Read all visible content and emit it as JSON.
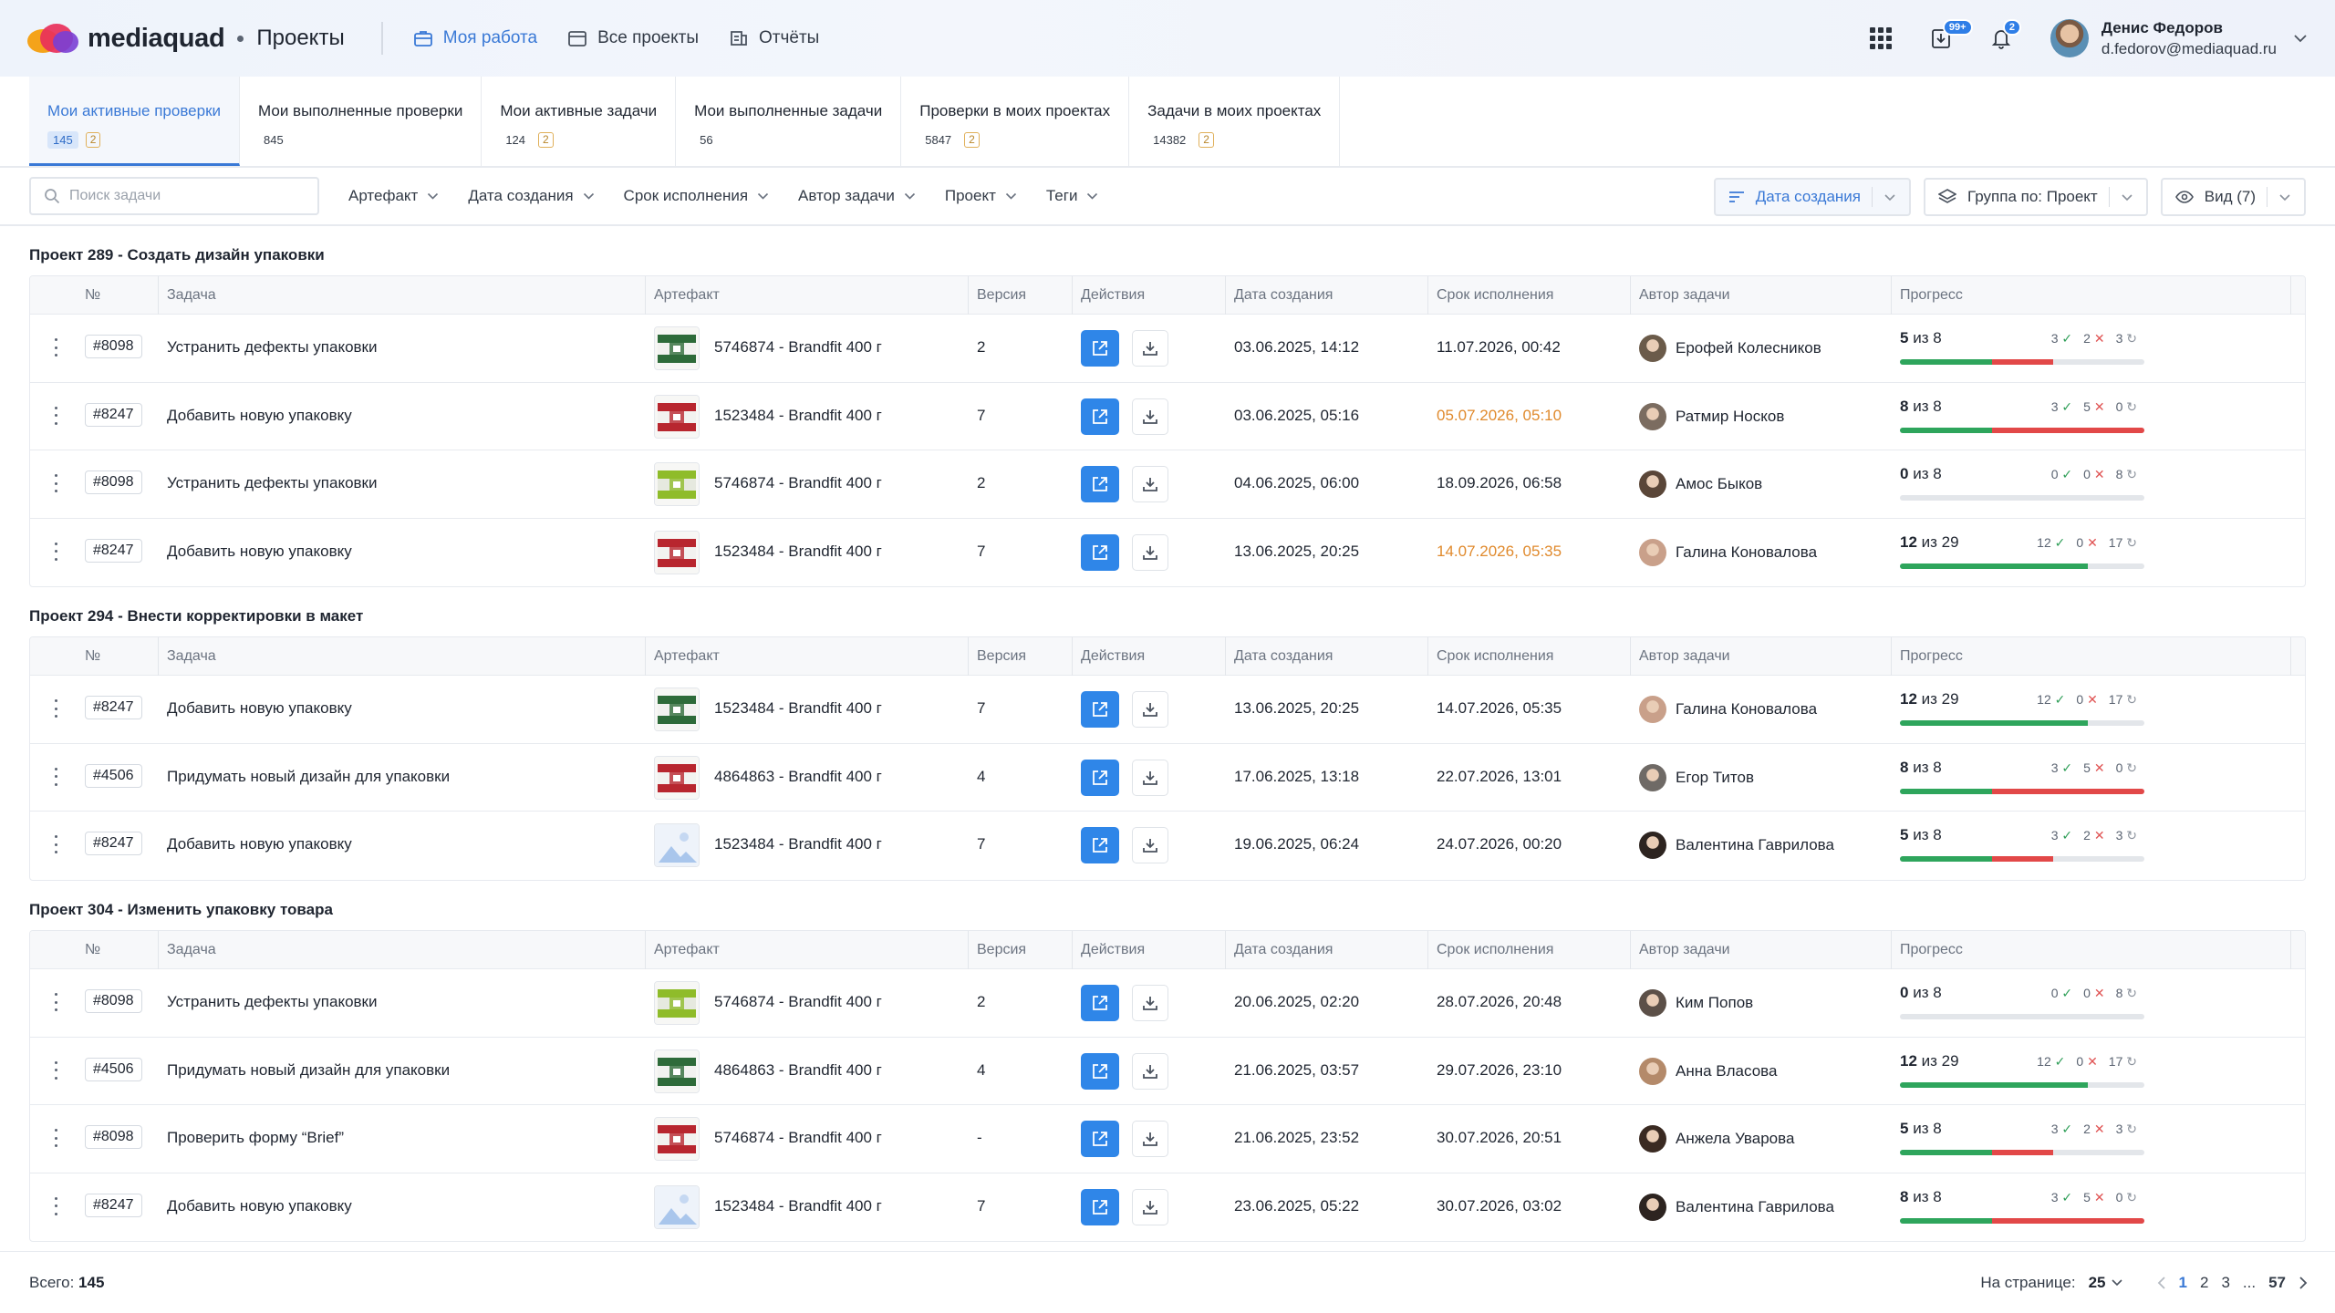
{
  "header": {
    "brand": "mediaquad",
    "section": "Проекты",
    "nav": [
      {
        "label": "Моя работа",
        "icon": "briefcase-icon",
        "active": true
      },
      {
        "label": "Все проекты",
        "icon": "calendar-icon",
        "active": false
      },
      {
        "label": "Отчёты",
        "icon": "report-icon",
        "active": false
      }
    ],
    "badges": {
      "downloads": "99+",
      "notifications": "2"
    },
    "user": {
      "name": "Денис Федоров",
      "email": "d.fedorov@mediaquad.ru"
    }
  },
  "tabs": [
    {
      "label": "Мои активные проверки",
      "count": "145",
      "warn": "2",
      "active": true
    },
    {
      "label": "Мои выполненные проверки",
      "count": "845",
      "warn": ""
    },
    {
      "label": "Мои активные задачи",
      "count": "124",
      "warn": "2"
    },
    {
      "label": "Мои выполненные задачи",
      "count": "56",
      "warn": ""
    },
    {
      "label": "Проверки в моих проектах",
      "count": "5847",
      "warn": "2"
    },
    {
      "label": "Задачи в моих проектах",
      "count": "14382",
      "warn": "2"
    }
  ],
  "filters": {
    "search_placeholder": "Поиск задачи",
    "items": [
      "Артефакт",
      "Дата создания",
      "Срок исполнения",
      "Автор задачи",
      "Проект",
      "Теги"
    ],
    "sort_label": "Дата создания",
    "group_label": "Группа по: Проект",
    "view_label": "Вид (7)"
  },
  "columns": [
    "№",
    "Задача",
    "Артефакт",
    "Версия",
    "Действия",
    "Дата создания",
    "Срок исполнения",
    "Автор задачи",
    "Прогресс"
  ],
  "groups": [
    {
      "title": "Проект 289 - Создать дизайн упаковки",
      "rows": [
        {
          "id": "#8098",
          "task": "Устранить дефекты упаковки",
          "thumb": "green",
          "artifact": "5746874 - Brandfit 400 г",
          "version": "2",
          "created": "03.06.2025, 14:12",
          "due": "11.07.2026, 00:42",
          "late": false,
          "author": "Ерофей Колесников",
          "avatar": "#6b5b4a",
          "done": "5",
          "total": "8",
          "ok": "3",
          "rej": "2",
          "wait": "3",
          "okf": 0.375,
          "rejf": 0.25
        },
        {
          "id": "#8247",
          "task": "Добавить новую упаковку",
          "thumb": "red",
          "artifact": "1523484 - Brandfit 400 г",
          "version": "7",
          "created": "03.06.2025, 05:16",
          "due": "05.07.2026, 05:10",
          "late": true,
          "author": "Ратмир Носков",
          "avatar": "#7b6c60",
          "done": "8",
          "total": "8",
          "ok": "3",
          "rej": "5",
          "wait": "0",
          "okf": 0.375,
          "rejf": 0.625
        },
        {
          "id": "#8098",
          "task": "Устранить дефекты упаковки",
          "thumb": "lime",
          "artifact": "5746874 - Brandfit 400 г",
          "version": "2",
          "created": "04.06.2025, 06:00",
          "due": "18.09.2026, 06:58",
          "late": false,
          "author": "Амос Быков",
          "avatar": "#5a4638",
          "done": "0",
          "total": "8",
          "ok": "0",
          "rej": "0",
          "wait": "8",
          "okf": 0,
          "rejf": 0
        },
        {
          "id": "#8247",
          "task": "Добавить новую упаковку",
          "thumb": "red",
          "artifact": "1523484 - Brandfit 400 г",
          "version": "7",
          "created": "13.06.2025, 20:25",
          "due": "14.07.2026, 05:35",
          "late": true,
          "author": "Галина Коновалова",
          "avatar": "#c9a08a",
          "done": "12",
          "total": "29",
          "ok": "12",
          "rej": "0",
          "wait": "17",
          "okf": 0.77,
          "rejf": 0
        }
      ]
    },
    {
      "title": "Проект 294 - Внести корректировки в макет",
      "rows": [
        {
          "id": "#8247",
          "task": "Добавить новую упаковку",
          "thumb": "green",
          "artifact": "1523484 - Brandfit 400 г",
          "version": "7",
          "created": "13.06.2025, 20:25",
          "due": "14.07.2026, 05:35",
          "late": false,
          "author": "Галина Коновалова",
          "avatar": "#c9a08a",
          "done": "12",
          "total": "29",
          "ok": "12",
          "rej": "0",
          "wait": "17",
          "okf": 0.77,
          "rejf": 0
        },
        {
          "id": "#4506",
          "task": "Придумать новый дизайн для упаковки",
          "thumb": "red",
          "artifact": "4864863 - Brandfit 400 г",
          "version": "4",
          "created": "17.06.2025, 13:18",
          "due": "22.07.2026, 13:01",
          "late": false,
          "author": "Егор Титов",
          "avatar": "#6f6a66",
          "done": "8",
          "total": "8",
          "ok": "3",
          "rej": "5",
          "wait": "0",
          "okf": 0.375,
          "rejf": 0.625
        },
        {
          "id": "#8247",
          "task": "Добавить новую упаковку",
          "thumb": "placeholder",
          "artifact": "1523484 - Brandfit 400 г",
          "version": "7",
          "created": "19.06.2025, 06:24",
          "due": "24.07.2026, 00:20",
          "late": false,
          "author": "Валентина Гаврилова",
          "avatar": "#2d2420",
          "done": "5",
          "total": "8",
          "ok": "3",
          "rej": "2",
          "wait": "3",
          "okf": 0.375,
          "rejf": 0.25
        }
      ]
    },
    {
      "title": "Проект 304 - Изменить упаковку товара",
      "rows": [
        {
          "id": "#8098",
          "task": "Устранить дефекты упаковки",
          "thumb": "lime",
          "artifact": "5746874 - Brandfit 400 г",
          "version": "2",
          "created": "20.06.2025, 02:20",
          "due": "28.07.2026, 20:48",
          "late": false,
          "author": "Ким Попов",
          "avatar": "#5c5048",
          "done": "0",
          "total": "8",
          "ok": "0",
          "rej": "0",
          "wait": "8",
          "okf": 0,
          "rejf": 0
        },
        {
          "id": "#4506",
          "task": "Придумать новый дизайн для упаковки",
          "thumb": "green",
          "artifact": "4864863 - Brandfit 400 г",
          "version": "4",
          "created": "21.06.2025, 03:57",
          "due": "29.07.2026, 23:10",
          "late": false,
          "author": "Анна Власова",
          "avatar": "#b48a6a",
          "done": "12",
          "total": "29",
          "ok": "12",
          "rej": "0",
          "wait": "17",
          "okf": 0.77,
          "rejf": 0
        },
        {
          "id": "#8098",
          "task": "Проверить форму “Brief”",
          "thumb": "red",
          "artifact": "5746874 - Brandfit 400 г",
          "version": "-",
          "created": "21.06.2025, 23:52",
          "due": "30.07.2026, 20:51",
          "late": false,
          "author": "Анжела Уварова",
          "avatar": "#3a2a22",
          "done": "5",
          "total": "8",
          "ok": "3",
          "rej": "2",
          "wait": "3",
          "okf": 0.375,
          "rejf": 0.25
        },
        {
          "id": "#8247",
          "task": "Добавить новую упаковку",
          "thumb": "placeholder",
          "artifact": "1523484 - Brandfit 400 г",
          "version": "7",
          "created": "23.06.2025, 05:22",
          "due": "30.07.2026, 03:02",
          "late": false,
          "author": "Валентина Гаврилова",
          "avatar": "#2d2420",
          "done": "8",
          "total": "8",
          "ok": "3",
          "rej": "5",
          "wait": "0",
          "okf": 0.375,
          "rejf": 0.625
        }
      ]
    }
  ],
  "footer": {
    "total_label": "Всего:",
    "total": "145",
    "per_page_label": "На странице:",
    "per_page": "25",
    "pages": [
      "1",
      "2",
      "3",
      "...",
      "57"
    ],
    "current_page": "1"
  },
  "colors": {
    "accent": "#3a79d6",
    "action": "#2f86e8",
    "ok": "#2ea55c",
    "reject": "#e24848",
    "late": "#e08a2d"
  }
}
